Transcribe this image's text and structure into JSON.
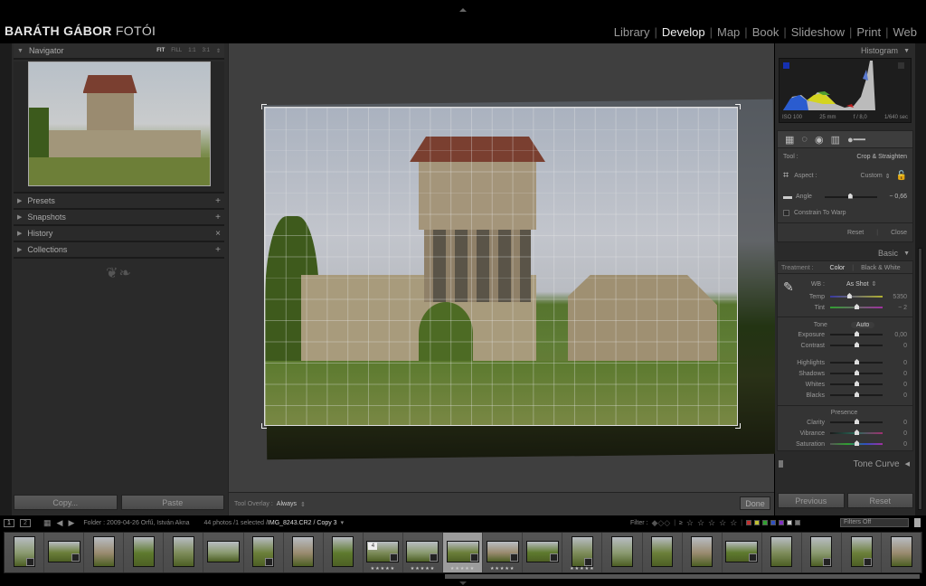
{
  "brand": {
    "bold": "BARÁTH GÁBOR",
    "light": "FOTÓI"
  },
  "modules": [
    {
      "label": "Library",
      "active": false
    },
    {
      "label": "Develop",
      "active": true
    },
    {
      "label": "Map",
      "active": false
    },
    {
      "label": "Book",
      "active": false
    },
    {
      "label": "Slideshow",
      "active": false
    },
    {
      "label": "Print",
      "active": false
    },
    {
      "label": "Web",
      "active": false
    }
  ],
  "left_panel": {
    "navigator": {
      "title": "Navigator",
      "zoom_options": [
        "FIT",
        "FILL",
        "1:1",
        "3:1"
      ],
      "zoom_selected": "FIT"
    },
    "sections": [
      {
        "label": "Presets",
        "action": "+"
      },
      {
        "label": "Snapshots",
        "action": "+"
      },
      {
        "label": "History",
        "action": "×"
      },
      {
        "label": "Collections",
        "action": "+"
      }
    ],
    "buttons": {
      "copy": "Copy...",
      "paste": "Paste"
    }
  },
  "toolbar": {
    "overlay_label": "Tool Overlay :",
    "overlay_value": "Always",
    "done": "Done"
  },
  "right_panel": {
    "histogram": {
      "title": "Histogram",
      "iso": "ISO 100",
      "focal": "25 mm",
      "aperture": "f / 8,0",
      "shutter": "1/640 sec"
    },
    "crop": {
      "tool_label": "Tool :",
      "tool_value": "Crop & Straighten",
      "aspect_label": "Aspect :",
      "aspect_value": "Custom",
      "angle_label": "Angle",
      "angle_value": "− 0,66",
      "angle_pos": 0.48,
      "constrain_label": "Constrain To Warp",
      "constrain_checked": false,
      "reset": "Reset",
      "close": "Close"
    },
    "basic": {
      "title": "Basic",
      "treatment_label": "Treatment :",
      "treatment_color": "Color",
      "treatment_bw": "Black & White",
      "wb_label": "WB :",
      "wb_value": "As Shot",
      "temp": {
        "label": "Temp",
        "value": "5350",
        "pos": 0.36
      },
      "tint": {
        "label": "Tint",
        "value": "− 2",
        "pos": 0.5
      },
      "tone_label": "Tone",
      "auto_label": "Auto",
      "tone": [
        {
          "label": "Exposure",
          "value": "0,00",
          "pos": 0.5
        },
        {
          "label": "Contrast",
          "value": "0",
          "pos": 0.5
        },
        {
          "label": "Highlights",
          "value": "0",
          "pos": 0.5
        },
        {
          "label": "Shadows",
          "value": "0",
          "pos": 0.5
        },
        {
          "label": "Whites",
          "value": "0",
          "pos": 0.5
        },
        {
          "label": "Blacks",
          "value": "0",
          "pos": 0.5
        }
      ],
      "presence_label": "Presence",
      "presence": [
        {
          "label": "Clarity",
          "value": "0",
          "pos": 0.5
        },
        {
          "label": "Vibrance",
          "value": "0",
          "pos": 0.5
        },
        {
          "label": "Saturation",
          "value": "0",
          "pos": 0.5
        }
      ]
    },
    "tone_curve": {
      "title": "Tone Curve"
    },
    "buttons": {
      "previous": "Previous",
      "reset": "Reset"
    }
  },
  "filmbar": {
    "screen1": "1",
    "screen2": "2",
    "folder": "Folder : 2009-04-26 Orfű, István Akna",
    "count": "44 photos /1 selected /",
    "filename": "IMG_8243.CR2 / Copy 3",
    "filter_label": "Filter :",
    "filter_stars": "≥",
    "color_labels": [
      "#c03030",
      "#c0c030",
      "#30a030",
      "#3050c0",
      "#8030c0",
      "#cccccc",
      "#777777"
    ],
    "filters_value": "Filters Off"
  },
  "filmstrip": [
    {
      "w": 24,
      "h": 34,
      "badge": true,
      "stars": "",
      "selected": false
    },
    {
      "w": 36,
      "h": 24,
      "badge": true,
      "stars": "",
      "selected": false
    },
    {
      "w": 24,
      "h": 34,
      "badge": false,
      "stars": "",
      "selected": false
    },
    {
      "w": 24,
      "h": 34,
      "badge": false,
      "stars": "",
      "selected": false
    },
    {
      "w": 24,
      "h": 34,
      "badge": false,
      "stars": "",
      "selected": false
    },
    {
      "w": 36,
      "h": 24,
      "badge": false,
      "stars": "",
      "selected": false
    },
    {
      "w": 24,
      "h": 34,
      "badge": true,
      "stars": "",
      "selected": false
    },
    {
      "w": 24,
      "h": 34,
      "badge": false,
      "stars": "",
      "selected": false
    },
    {
      "w": 24,
      "h": 34,
      "badge": false,
      "stars": "",
      "selected": false
    },
    {
      "w": 36,
      "h": 24,
      "badge": true,
      "stars": "★★★★★",
      "selected": false,
      "stack": "4"
    },
    {
      "w": 36,
      "h": 24,
      "badge": true,
      "stars": "★★★★★",
      "selected": false
    },
    {
      "w": 36,
      "h": 24,
      "badge": true,
      "stars": "★★★★★",
      "selected": true
    },
    {
      "w": 36,
      "h": 24,
      "badge": true,
      "stars": "★★★★★",
      "selected": false
    },
    {
      "w": 36,
      "h": 24,
      "badge": true,
      "stars": "",
      "selected": false
    },
    {
      "w": 24,
      "h": 34,
      "badge": true,
      "stars": "★★★★★",
      "selected": false
    },
    {
      "w": 24,
      "h": 34,
      "badge": false,
      "stars": "",
      "selected": false
    },
    {
      "w": 24,
      "h": 34,
      "badge": false,
      "stars": "",
      "selected": false
    },
    {
      "w": 24,
      "h": 34,
      "badge": false,
      "stars": "",
      "selected": false
    },
    {
      "w": 36,
      "h": 24,
      "badge": true,
      "stars": "",
      "selected": false
    },
    {
      "w": 24,
      "h": 34,
      "badge": false,
      "stars": "",
      "selected": false
    },
    {
      "w": 24,
      "h": 34,
      "badge": true,
      "stars": "",
      "selected": false
    },
    {
      "w": 24,
      "h": 34,
      "badge": true,
      "stars": "",
      "selected": false
    },
    {
      "w": 24,
      "h": 34,
      "badge": false,
      "stars": "",
      "selected": false
    }
  ]
}
